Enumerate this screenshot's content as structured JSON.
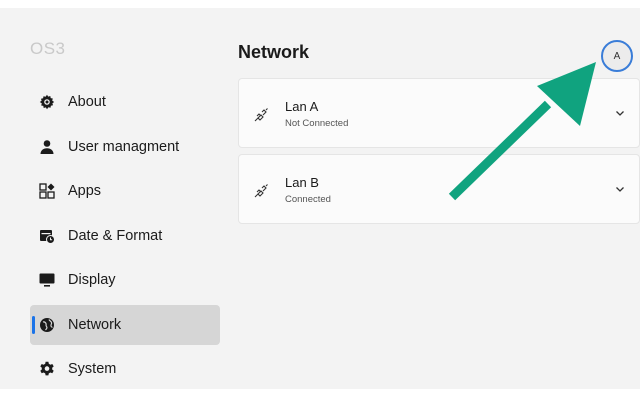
{
  "app": {
    "brand": "OS3"
  },
  "sidebar": {
    "items": [
      {
        "label": "About",
        "icon": "gear-icon",
        "active": false
      },
      {
        "label": "User managment",
        "icon": "user-icon",
        "active": false
      },
      {
        "label": "Apps",
        "icon": "apps-icon",
        "active": false
      },
      {
        "label": "Date & Format",
        "icon": "calendar-icon",
        "active": false
      },
      {
        "label": "Display",
        "icon": "monitor-icon",
        "active": false
      },
      {
        "label": "Network",
        "icon": "globe-icon",
        "active": true
      },
      {
        "label": "System",
        "icon": "settings-icon",
        "active": false
      }
    ]
  },
  "header": {
    "title": "Network",
    "avatar_initial": "A"
  },
  "networks": [
    {
      "name": "Lan A",
      "status": "Not Connected",
      "icon": "ethernet-icon"
    },
    {
      "name": "Lan B",
      "status": "Connected",
      "icon": "ethernet-icon"
    }
  ],
  "colors": {
    "accent": "#1a73e8",
    "annotation_arrow": "#10a37f",
    "active_item_bg": "#d6d6d6"
  }
}
